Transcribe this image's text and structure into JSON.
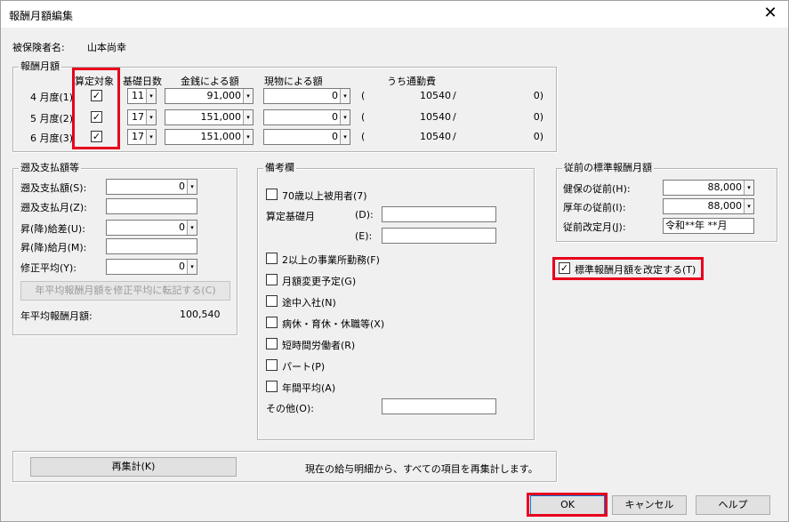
{
  "window": {
    "title": "報酬月額編集",
    "close_glyph": "✕"
  },
  "insured": {
    "label": "被保険者名:",
    "name": "山本尚幸"
  },
  "monthly": {
    "legend": "報酬月額",
    "headers": {
      "target": "算定対象",
      "days": "基礎日数",
      "cash": "金銭による額",
      "kind": "現物による額",
      "commute": "うち通勤費"
    },
    "rows": [
      {
        "label": "4 月度(1)",
        "checked": "✓",
        "days": "11",
        "cash": "91,000",
        "kind": "0",
        "paren": "(",
        "commute": "10540",
        "slash": "/",
        "close": "0)"
      },
      {
        "label": "5 月度(2)",
        "checked": "✓",
        "days": "17",
        "cash": "151,000",
        "kind": "0",
        "paren": "(",
        "commute": "10540",
        "slash": "/",
        "close": "0)"
      },
      {
        "label": "6 月度(3)",
        "checked": "✓",
        "days": "17",
        "cash": "151,000",
        "kind": "0",
        "paren": "(",
        "commute": "10540",
        "slash": "/",
        "close": "0)"
      }
    ]
  },
  "retro": {
    "legend": "遡及支払額等",
    "amount_label": "遡及支払額(S):",
    "amount_value": "0",
    "month_label": "遡及支払月(Z):",
    "month_value": "",
    "diff_label": "昇(降)給差(U):",
    "diff_value": "0",
    "raise_month_label": "昇(降)給月(M):",
    "raise_month_value": "",
    "avg_label": "修正平均(Y):",
    "avg_value": "0",
    "transfer_button": "年平均報酬月額を修正平均に転記する(C)",
    "annual_label": "年平均報酬月額:",
    "annual_value": "100,540"
  },
  "remarks": {
    "legend": "備考欄",
    "over70": "70歳以上被用者(7)",
    "calc_days": "算定基礎月",
    "d_label": "(D):",
    "d_value": "",
    "e_label": "(E):",
    "e_value": "",
    "multi_office": "2以上の事業所勤務(F)",
    "amount_change": "月額変更予定(G)",
    "mid_join": "途中入社(N)",
    "leave": "病休・育休・休職等(X)",
    "short_time": "短時間労働者(R)",
    "part": "パート(P)",
    "annual_avg": "年間平均(A)",
    "other_label": "その他(O):",
    "other_value": ""
  },
  "previous": {
    "legend": "従前の標準報酬月額",
    "health_label": "健保の従前(H):",
    "health_value": "88,000",
    "pension_label": "厚年の従前(I):",
    "pension_value": "88,000",
    "revision_label": "従前改定月(J):",
    "revision_value": "令和**年 **月"
  },
  "revise_checkbox": {
    "label": "標準報酬月額を改定する(T)",
    "checked": "✓"
  },
  "recalc": {
    "button": "再集計(K)",
    "description": "現在の給与明細から、すべての項目を再集計します。"
  },
  "footer": {
    "ok": "OK",
    "cancel": "キャンセル",
    "help": "ヘルプ"
  },
  "arrow_glyph": "▾",
  "highlight_color": "#e8001c"
}
